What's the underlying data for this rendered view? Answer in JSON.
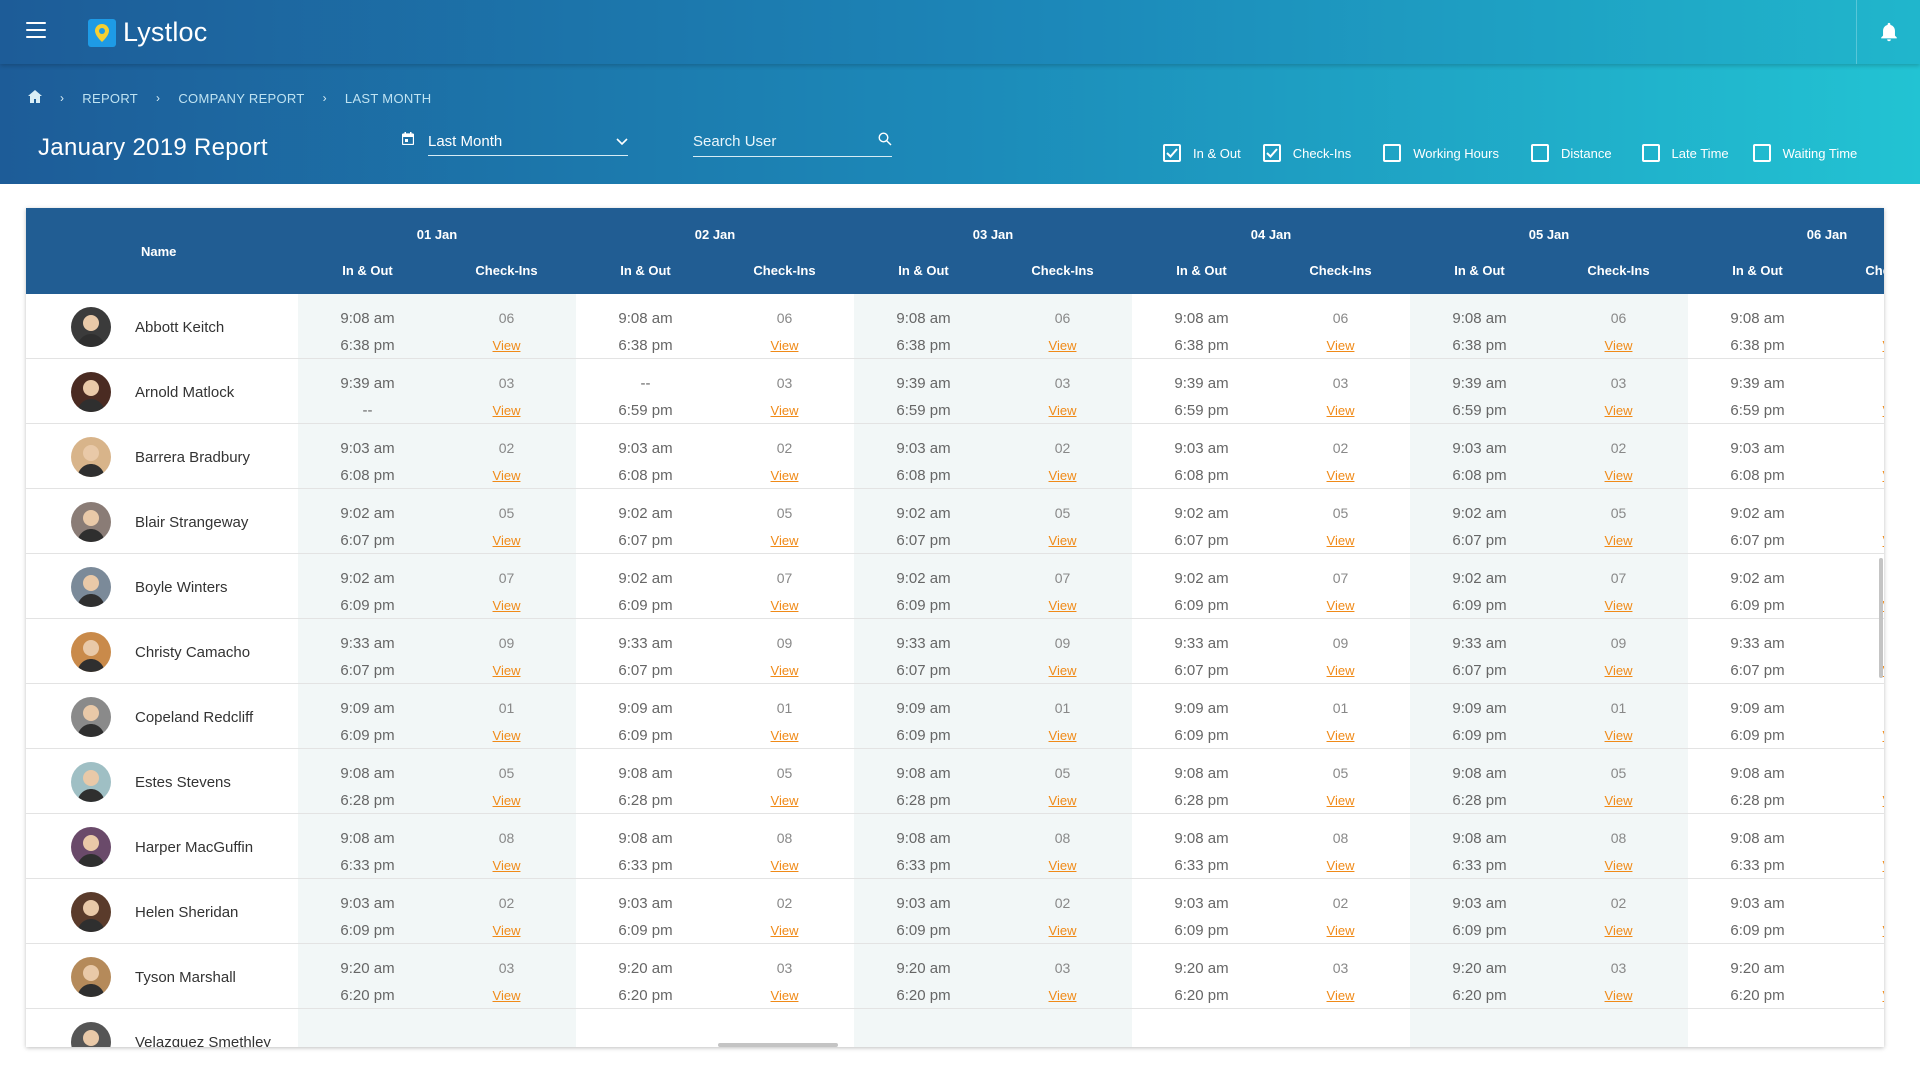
{
  "app": {
    "name": "Lystloc",
    "icons": {
      "menu": "menu-icon",
      "logo": "location-pin-icon",
      "notifications": "bell-icon"
    }
  },
  "breadcrumb": {
    "home_icon": "home-icon",
    "items": [
      "REPORT",
      "COMPANY REPORT",
      "LAST MONTH"
    ]
  },
  "page_title": "January 2019 Report",
  "filters_bar": {
    "period_icon": "calendar-icon",
    "period_value": "Last Month",
    "search_placeholder": "Search User",
    "checkboxes": [
      {
        "label": "In & Out",
        "checked": true
      },
      {
        "label": "Check-Ins",
        "checked": true
      },
      {
        "label": "Working Hours",
        "checked": false
      },
      {
        "label": "Distance",
        "checked": false
      },
      {
        "label": "Late Time",
        "checked": false
      },
      {
        "label": "Waiting Time",
        "checked": false
      }
    ]
  },
  "table": {
    "name_header": "Name",
    "days": [
      "01 Jan",
      "02 Jan",
      "03 Jan",
      "04 Jan",
      "05 Jan",
      "06 Jan"
    ],
    "sub_headers": [
      "In & Out",
      "Check-Ins"
    ],
    "view_label": "View",
    "rows": [
      {
        "name": "Abbott Keitch",
        "in": "9:08 am",
        "out": "6:38 pm",
        "checkins": "06"
      },
      {
        "name": "Arnold Matlock",
        "in": "9:39 am",
        "out": "--",
        "checkins": "03"
      },
      {
        "name": "Barrera Bradbury",
        "in": "9:03 am",
        "out": "6:08 pm",
        "checkins": "02"
      },
      {
        "name": "Blair Strangeway",
        "in": "9:02 am",
        "out": "6:07 pm",
        "checkins": "05"
      },
      {
        "name": "Boyle Winters",
        "in": "9:02 am",
        "out": "6:09 pm",
        "checkins": "07"
      },
      {
        "name": "Christy Camacho",
        "in": "9:33 am",
        "out": "6:07 pm",
        "checkins": "09"
      },
      {
        "name": "Copeland Redcliff",
        "in": "9:09 am",
        "out": "6:09 pm",
        "checkins": "01"
      },
      {
        "name": "Estes Stevens",
        "in": "9:08 am",
        "out": "6:28 pm",
        "checkins": "05"
      },
      {
        "name": "Harper MacGuffin",
        "in": "9:08 am",
        "out": "6:33 pm",
        "checkins": "08"
      },
      {
        "name": "Helen Sheridan",
        "in": "9:03 am",
        "out": "6:09 pm",
        "checkins": "02"
      },
      {
        "name": "Tyson Marshall",
        "in": "9:20 am",
        "out": "6:20 pm",
        "checkins": "03"
      },
      {
        "name": "Velazquez Smethley"
      }
    ],
    "overrides": {
      "1": {
        "1": {
          "in": "--",
          "out": "6:59 pm"
        },
        "2": {
          "out": "6:59 pm"
        },
        "3": {
          "out": "6:59 pm"
        },
        "4": {
          "out": "6:59 pm"
        },
        "5": {
          "out": "6:59 pm"
        }
      }
    }
  },
  "colors": {
    "header_start": "#1d5c98",
    "header_end": "#22c3d3",
    "table_header": "#215d93",
    "link": "#f08a18",
    "row_shade": "#f2f7f7"
  }
}
